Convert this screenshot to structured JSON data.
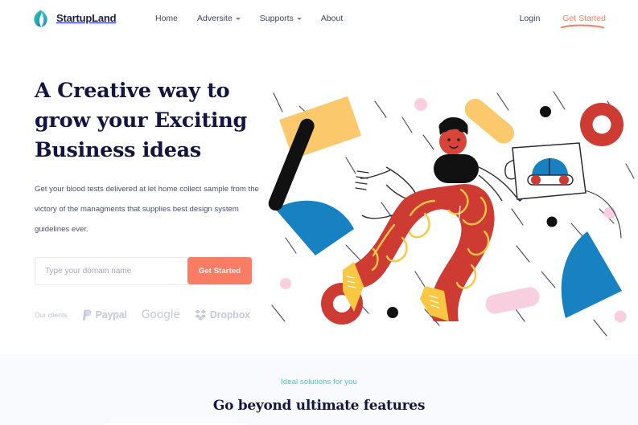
{
  "brand": {
    "name": "StartupLand",
    "logo_icon": "leaf-logo-icon",
    "logo_gradient_from": "#2ecfa8",
    "logo_gradient_to": "#1f5fd0"
  },
  "nav": {
    "links": [
      {
        "label": "Home",
        "has_dropdown": false
      },
      {
        "label": "Adversite",
        "has_dropdown": true
      },
      {
        "label": "Supports",
        "has_dropdown": true
      },
      {
        "label": "About",
        "has_dropdown": false
      }
    ],
    "login_label": "Login",
    "cta_label": "Get Started",
    "cta_color": "#fa7c65"
  },
  "hero": {
    "title_lines": [
      "A Creative way to",
      "grow your Exciting",
      "Business ideas"
    ],
    "title_color": "#141442",
    "subtitle": "Get your blood tests delivered at let home collect sample from the victory of the managments that supplies best design system guidelines ever.",
    "form": {
      "input_placeholder": "Type your domain name",
      "input_value": "",
      "button_label": "Get Started",
      "button_color": "#fa7c65"
    },
    "clients": {
      "label": "Our clients",
      "logos": [
        {
          "name": "Paypal",
          "icon": "paypal-icon"
        },
        {
          "name": "Google",
          "icon": "google-wordmark-icon"
        },
        {
          "name": "Dropbox",
          "icon": "dropbox-icon"
        }
      ]
    }
  },
  "illustration": {
    "name": "creative-person-flat-illustration",
    "palette": {
      "blue": "#1781c2",
      "red": "#ce3b33",
      "yellow": "#fbc96c",
      "gold": "#f9c741",
      "pink": "#f8cfdf",
      "black": "#111111",
      "line": "#2a2a3a"
    }
  },
  "features": {
    "eyebrow": "Ideal solutions for you",
    "eyebrow_color": "#3ad0b0",
    "title": "Go beyond ultimate features",
    "background": "#f9fafd"
  }
}
